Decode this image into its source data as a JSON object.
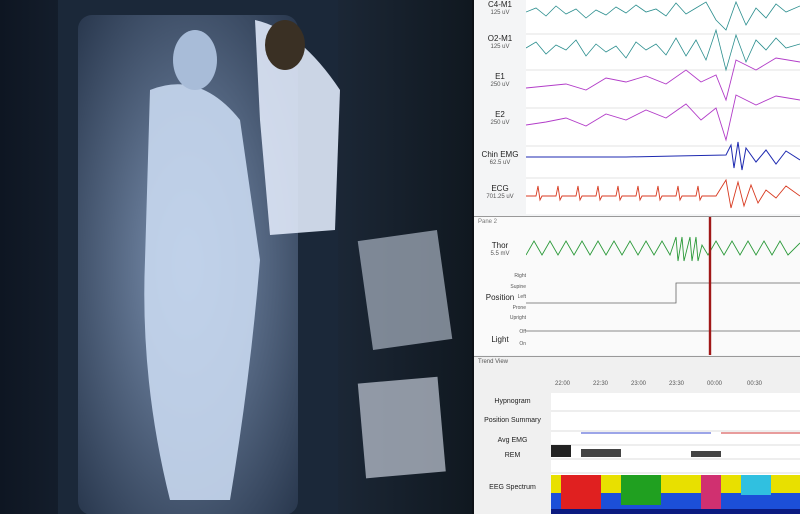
{
  "video": {
    "scene": "night-vision-patient-feed"
  },
  "eeg_channels": [
    {
      "name": "C4-M1",
      "unit": "125 uV",
      "color": "#2b8e8e"
    },
    {
      "name": "O2-M1",
      "unit": "125 uV",
      "color": "#2b8e8e"
    },
    {
      "name": "E1",
      "unit": "250 uV",
      "color": "#b23cc8"
    },
    {
      "name": "E2",
      "unit": "250 uV",
      "color": "#b23cc8"
    },
    {
      "name": "Chin EMG",
      "unit": "62.5 uV",
      "color": "#1e2ab0"
    },
    {
      "name": "ECG",
      "unit": "701.25 uV",
      "color": "#d83a20"
    }
  ],
  "pane2": {
    "title": "Pane 2",
    "thor": {
      "name": "Thor",
      "unit": "5.5 mV",
      "color": "#2c9a3a"
    },
    "position": {
      "name": "Position",
      "levels": [
        "Right",
        "Supine",
        "Left",
        "Prone",
        "Upright"
      ]
    },
    "light": {
      "name": "Light",
      "levels": [
        "Off",
        "On"
      ]
    }
  },
  "trend": {
    "title": "Trend View",
    "times": [
      "22:00",
      "22:30",
      "23:00",
      "23:30",
      "00:00",
      "00:30"
    ],
    "rows": [
      "Hypnogram",
      "Position Summary",
      "Avg EMG",
      "REM",
      "EEG Spectrum"
    ]
  },
  "colors": {
    "cursor": "#a01818",
    "panel_bg": "#f4f5f6"
  }
}
